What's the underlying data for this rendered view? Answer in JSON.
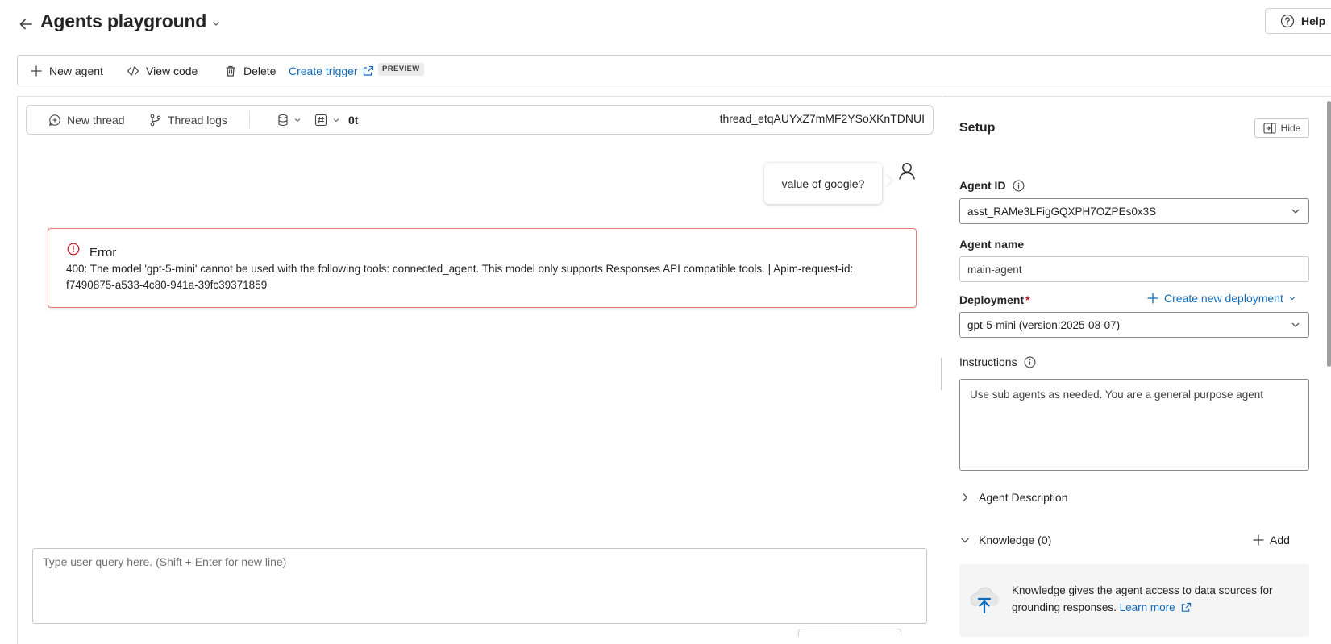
{
  "header": {
    "title": "Agents playground",
    "help_label": "Help"
  },
  "toolbar": {
    "new_agent": "New agent",
    "view_code": "View code",
    "delete": "Delete",
    "create_trigger": "Create trigger",
    "preview_badge": "PREVIEW"
  },
  "thread_bar": {
    "new_thread": "New thread",
    "thread_logs": "Thread logs",
    "token_count": "0t",
    "thread_id": "thread_etqAUYxZ7mMF2YSoXKnTDNUI"
  },
  "chat": {
    "user_message": "value of google?",
    "error": {
      "title": "Error",
      "message": "400: The model 'gpt-5-mini' cannot be used with the following tools: connected_agent. This model only supports Responses API compatible tools. | Apim-request-id: f7490875-a533-4c80-941a-39fc39371859"
    },
    "query_placeholder": "Type user query here. (Shift + Enter for new line)"
  },
  "setup": {
    "title": "Setup",
    "hide_label": "Hide",
    "agent_id_label": "Agent ID",
    "agent_id_value": "asst_RAMe3LFigGQXPH7OZPEs0x3S",
    "agent_name_label": "Agent name",
    "agent_name_value": "main-agent",
    "deployment_label": "Deployment",
    "deployment_required": "*",
    "create_deployment": "Create new deployment",
    "deployment_value": "gpt-5-mini (version:2025-08-07)",
    "instructions_label": "Instructions",
    "instructions_value": "Use sub agents as needed. You are a general purpose agent",
    "agent_description_label": "Agent Description",
    "knowledge_label": "Knowledge (0)",
    "add_label": "Add",
    "knowledge_text": "Knowledge gives the agent access to data sources for grounding responses.",
    "learn_more": "Learn more"
  },
  "colors": {
    "accent": "#0f6cbd",
    "error_border": "#e87979",
    "error_icon": "#c50f1f",
    "required": "#c50f1f"
  }
}
